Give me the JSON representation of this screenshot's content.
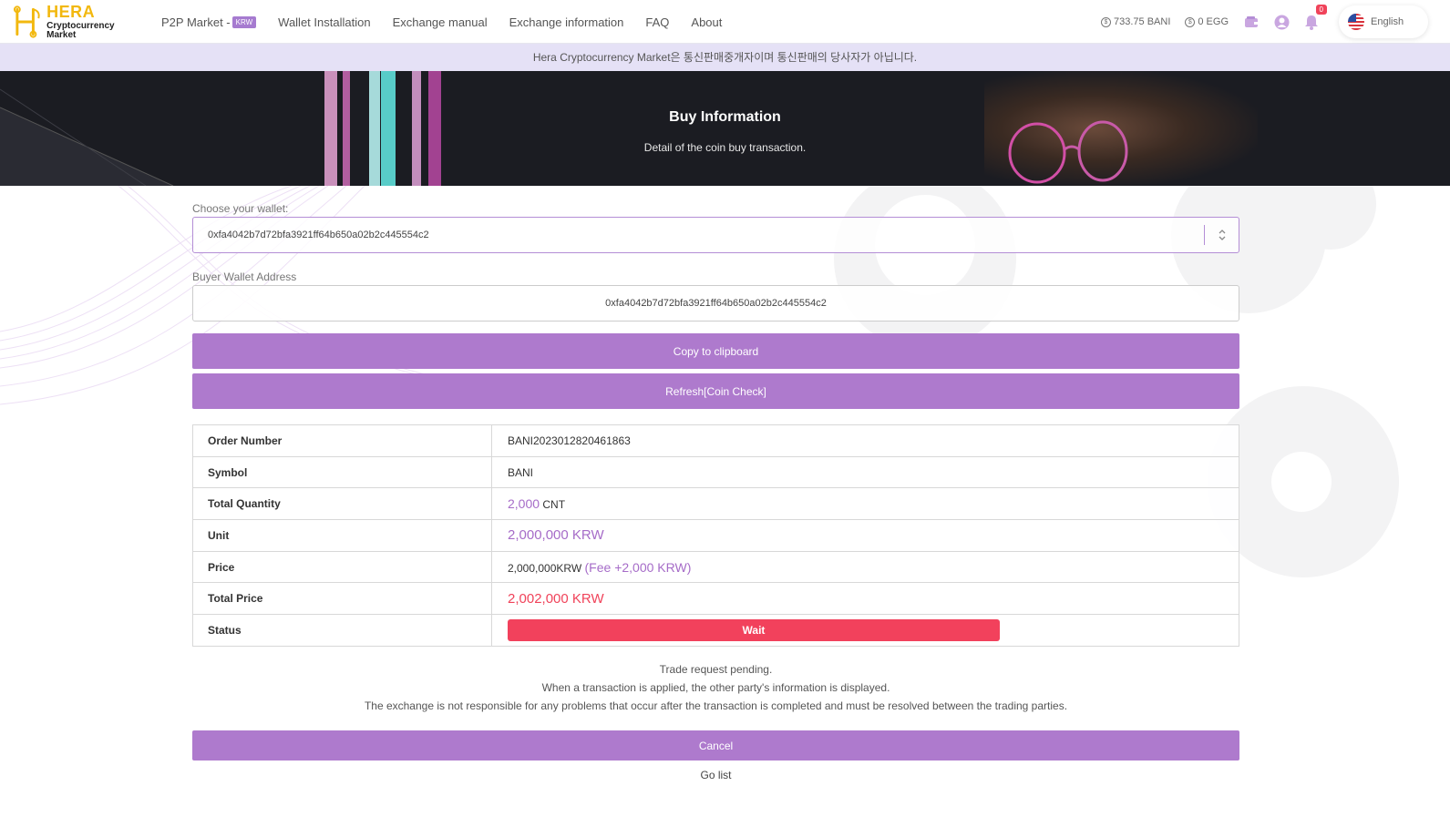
{
  "brand": {
    "name": "HERA",
    "subtitle": "Cryptocurrency Market",
    "color": "#f2b80f"
  },
  "nav": {
    "items": [
      {
        "label": "P2P Market -",
        "badge": "KRW"
      },
      {
        "label": "Wallet Installation"
      },
      {
        "label": "Exchange manual"
      },
      {
        "label": "Exchange information"
      },
      {
        "label": "FAQ"
      },
      {
        "label": "About"
      }
    ],
    "balances": [
      "733.75 BANI",
      "0 EGG"
    ],
    "notification_count": "0",
    "language": "English"
  },
  "notice": "Hera Cryptocurrency Market은 통신판매중개자이며 통신판매의 당사자가 아닙니다.",
  "hero": {
    "title": "Buy Information",
    "subtitle": "Detail of the coin buy transaction."
  },
  "form": {
    "wallet_label": "Choose your wallet:",
    "wallet_value": "0xfa4042b7d72bfa3921ff64b650a02b2c445554c2",
    "buyer_label": "Buyer Wallet Address",
    "buyer_value": "0xfa4042b7d72bfa3921ff64b650a02b2c445554c2",
    "copy_label": "Copy to clipboard",
    "refresh_label": "Refresh[Coin Check]"
  },
  "order": {
    "order_number_label": "Order Number",
    "order_number": "BANI2023012820461863",
    "symbol_label": "Symbol",
    "symbol": "BANI",
    "quantity_label": "Total Quantity",
    "quantity": "2,000",
    "quantity_unit": "CNT",
    "unit_label": "Unit",
    "unit": "2,000,000 KRW",
    "price_label": "Price",
    "price": "2,000,000KRW",
    "fee": "(Fee +2,000 KRW)",
    "total_label": "Total Price",
    "total": "2,002,000 KRW",
    "status_label": "Status",
    "status": "Wait"
  },
  "messages": {
    "line1": "Trade request pending.",
    "line2": "When a transaction is applied, the other party's information is displayed.",
    "line3": "The exchange is not responsible for any problems that occur after the transaction is completed and must be resolved between the trading parties."
  },
  "actions": {
    "cancel": "Cancel",
    "go_list": "Go list"
  },
  "colors": {
    "accent": "#ae7acd",
    "status_red": "#f2415c",
    "notice_bg": "#e5e1f6"
  }
}
